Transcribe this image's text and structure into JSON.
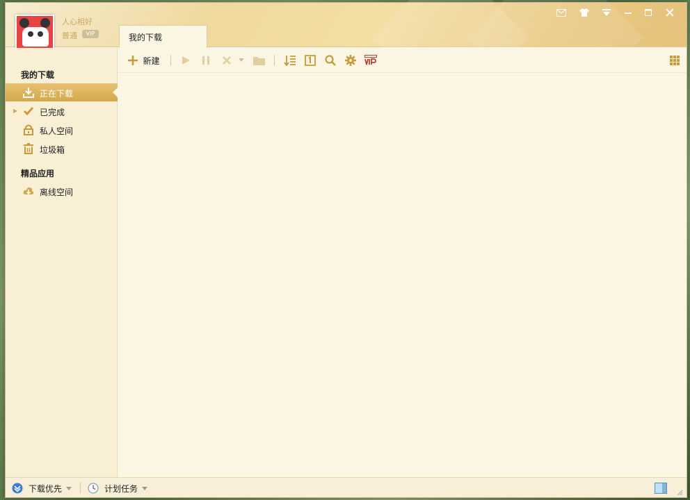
{
  "user": {
    "name": "人心相好",
    "level": "普通"
  },
  "tab": {
    "label": "我的下载"
  },
  "sidebar": {
    "section1_title": "我的下载",
    "items": [
      {
        "label": "正在下载",
        "icon": "download-icon"
      },
      {
        "label": "已完成",
        "icon": "check-icon"
      },
      {
        "label": "私人空间",
        "icon": "lock-icon"
      },
      {
        "label": "垃圾箱",
        "icon": "trash-icon"
      }
    ],
    "section2_title": "精品应用",
    "apps": [
      {
        "label": "离线空间",
        "icon": "cloud-icon"
      }
    ]
  },
  "toolbar": {
    "new_label": "新建"
  },
  "statusbar": {
    "priority_label": "下载优先",
    "schedule_label": "计划任务"
  },
  "colors": {
    "accent": "#d4a84c",
    "icon": "#c79a3a",
    "vip": "#c0392b"
  }
}
